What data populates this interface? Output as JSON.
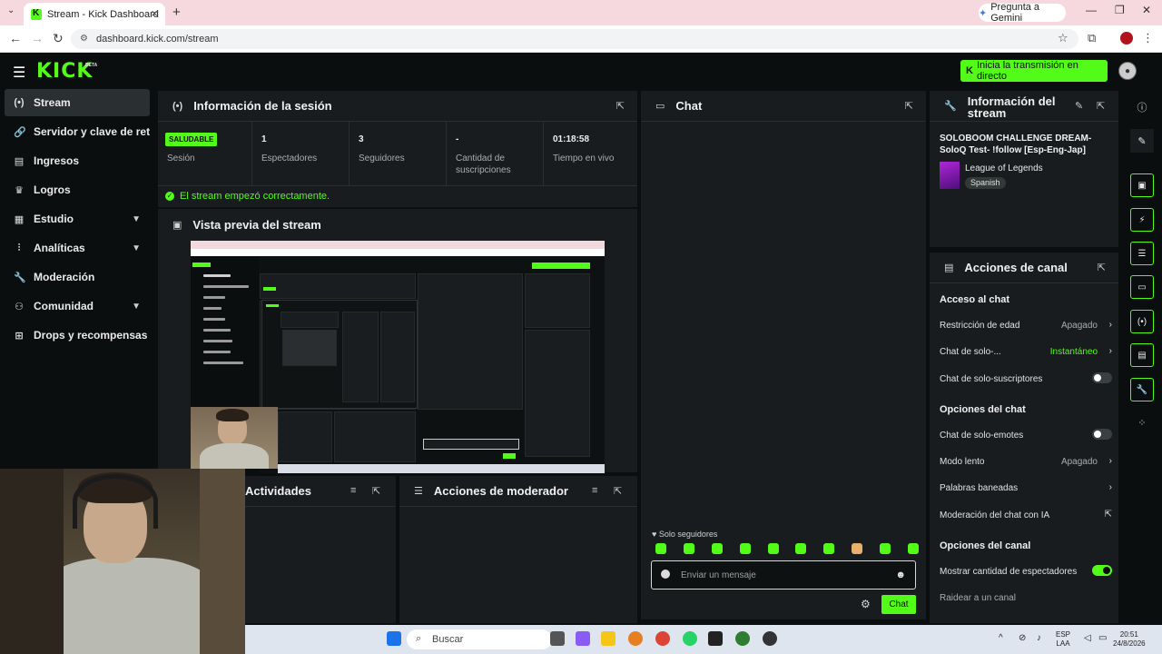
{
  "browser": {
    "tab_title": "Stream - Kick Dashboard",
    "gemini_label": "Pregunta a Gemini",
    "url": "dashboard.kick.com/stream"
  },
  "header": {
    "logo": "KICK",
    "beta": "BETA",
    "go_live": "Inicia la transmisión en directo"
  },
  "sidebar": {
    "items": [
      {
        "label": "Stream",
        "icon": "broadcast-icon"
      },
      {
        "label": "Servidor y clave de retransmisión",
        "icon": "link-icon"
      },
      {
        "label": "Ingresos",
        "icon": "money-icon"
      },
      {
        "label": "Logros",
        "icon": "trophy-icon"
      },
      {
        "label": "Estudio",
        "icon": "studio-icon"
      },
      {
        "label": "Analíticas",
        "icon": "chart-icon"
      },
      {
        "label": "Moderación",
        "icon": "wrench-icon"
      },
      {
        "label": "Comunidad",
        "icon": "people-icon"
      },
      {
        "label": "Drops y recompensas",
        "icon": "gift-icon"
      }
    ]
  },
  "session": {
    "title": "Información de la sesión",
    "health": "SALUDABLE",
    "stats": [
      {
        "value": "",
        "label": "Sesión"
      },
      {
        "value": "1",
        "label": "Espectadores"
      },
      {
        "value": "3",
        "label": "Seguidores"
      },
      {
        "value": "-",
        "label": "Cantidad de suscripciones"
      },
      {
        "value": "01:18:58",
        "label": "Tiempo en vivo"
      }
    ],
    "status": "El stream empezó correctamente."
  },
  "preview": {
    "title": "Vista previa del stream"
  },
  "activity": {
    "title": "Actividades"
  },
  "mod_actions": {
    "title": "Acciones de moderador"
  },
  "chat": {
    "title": "Chat",
    "followers_only": "Solo seguidores",
    "placeholder": "Enviar un mensaje",
    "send": "Chat"
  },
  "stream_info": {
    "title_line1": "Información del",
    "title_line2": "stream",
    "stream_title": "SOLOBOOM CHALLENGE DREAM- SoloQ Test- !follow [Esp-Eng-Jap]",
    "category": "League of Legends",
    "language": "Spanish"
  },
  "channel_actions": {
    "title": "Acciones de canal",
    "chat_access": "Acceso al chat",
    "age_restriction": "Restricción de edad",
    "age_value": "Apagado",
    "chat_only": "Chat de solo-...",
    "chat_only_value": "Instantáneo",
    "subs_only": "Chat de solo-suscriptores",
    "chat_options": "Opciones del chat",
    "emotes_only": "Chat de solo-emotes",
    "slow_mode": "Modo lento",
    "slow_value": "Apagado",
    "banned_words": "Palabras baneadas",
    "ai_mod": "Moderación del chat con IA",
    "channel_options": "Opciones del canal",
    "show_viewers": "Mostrar cantidad de espectadores",
    "raid": "Raidear a un canal"
  },
  "taskbar": {
    "search": "Buscar",
    "lang1": "ESP",
    "lang2": "LAA",
    "time": "20:51",
    "date": "24/8/2026"
  },
  "colors": {
    "accent": "#53fc18",
    "panel": "#191c1e",
    "background": "#0b0e0f"
  }
}
